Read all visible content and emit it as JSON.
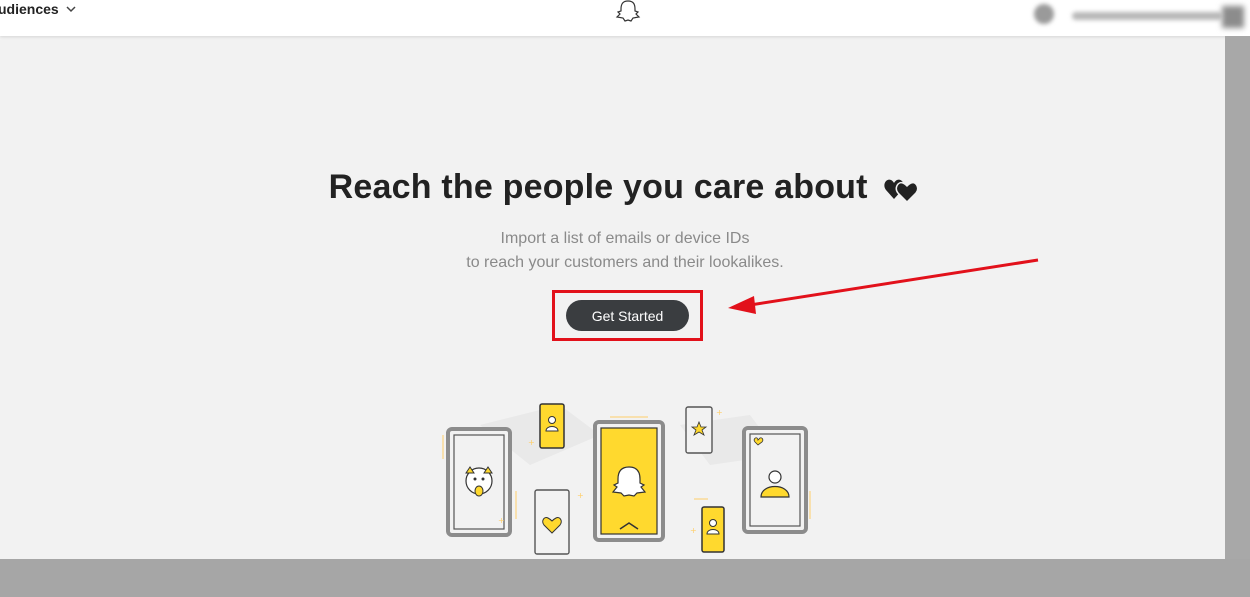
{
  "header": {
    "nav_label": "udiences",
    "logo_icon": "snapchat-ghost-icon",
    "user_area_icon": "avatar-icon"
  },
  "main": {
    "headline": "Reach the people you care about",
    "headline_icon": "two-hearts-icon",
    "subtitle_line1": "Import a list of emails or device IDs",
    "subtitle_line2": "to reach your customers and their lookalikes.",
    "cta_label": "Get Started"
  },
  "annotation": {
    "highlight_color": "#e2111b",
    "arrow_color": "#e2111b"
  },
  "colors": {
    "accent_yellow": "#ffd92e",
    "button_dark": "#3a3d40",
    "background": "#f2f2f2"
  }
}
